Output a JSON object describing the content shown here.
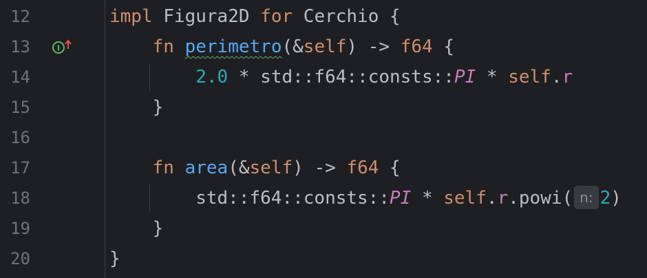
{
  "editor": {
    "lines": [
      {
        "number": "12",
        "tokens": [
          {
            "t": "impl",
            "c": "kw"
          },
          {
            "t": " Figura2D "
          },
          {
            "t": "for",
            "c": "kw"
          },
          {
            "t": " Cerchio {"
          }
        ]
      },
      {
        "number": "13",
        "tokens": [
          {
            "t": "    "
          },
          {
            "t": "fn",
            "c": "kw"
          },
          {
            "t": " "
          },
          {
            "t": "perimetro",
            "c": "fn squiggle"
          },
          {
            "t": "(&"
          },
          {
            "t": "self",
            "c": "kw"
          },
          {
            "t": ") -> "
          },
          {
            "t": "f64",
            "c": "kw"
          },
          {
            "t": " {"
          }
        ]
      },
      {
        "number": "14",
        "tokens": [
          {
            "t": "        "
          },
          {
            "t": "2.0",
            "c": "num"
          },
          {
            "t": " * std::f64::consts::"
          },
          {
            "t": "PI",
            "c": "const"
          },
          {
            "t": " * "
          },
          {
            "t": "self",
            "c": "kw"
          },
          {
            "t": "."
          },
          {
            "t": "r",
            "c": "field"
          }
        ]
      },
      {
        "number": "15",
        "tokens": [
          {
            "t": "    }"
          }
        ]
      },
      {
        "number": "16",
        "tokens": []
      },
      {
        "number": "17",
        "tokens": [
          {
            "t": "    "
          },
          {
            "t": "fn",
            "c": "kw"
          },
          {
            "t": " "
          },
          {
            "t": "area",
            "c": "fn"
          },
          {
            "t": "(&"
          },
          {
            "t": "self",
            "c": "kw"
          },
          {
            "t": ") -> "
          },
          {
            "t": "f64",
            "c": "kw"
          },
          {
            "t": " {"
          }
        ]
      },
      {
        "number": "18",
        "tokens": [
          {
            "t": "        std::f64::consts::"
          },
          {
            "t": "PI",
            "c": "const"
          },
          {
            "t": " * "
          },
          {
            "t": "self",
            "c": "kw"
          },
          {
            "t": "."
          },
          {
            "t": "r",
            "c": "field"
          },
          {
            "t": ".powi("
          },
          {
            "t": "n:",
            "c": "hint"
          },
          {
            "t": "2",
            "c": "num"
          },
          {
            "t": ")"
          }
        ]
      },
      {
        "number": "19",
        "tokens": [
          {
            "t": "    }"
          }
        ]
      },
      {
        "number": "20",
        "tokens": [
          {
            "t": "}"
          }
        ]
      }
    ],
    "gutter_icon": {
      "name": "implementing-method-icon",
      "glyph": "I",
      "color": "#5fb865",
      "arrow_color": "#e5544b"
    }
  },
  "colors": {
    "background": "#1e1f22",
    "keyword": "#cf8e6d",
    "function": "#56a8f5",
    "number": "#2aacb8",
    "constant": "#c77dbb",
    "text": "#bcbec4",
    "line_number": "#6f737a"
  }
}
